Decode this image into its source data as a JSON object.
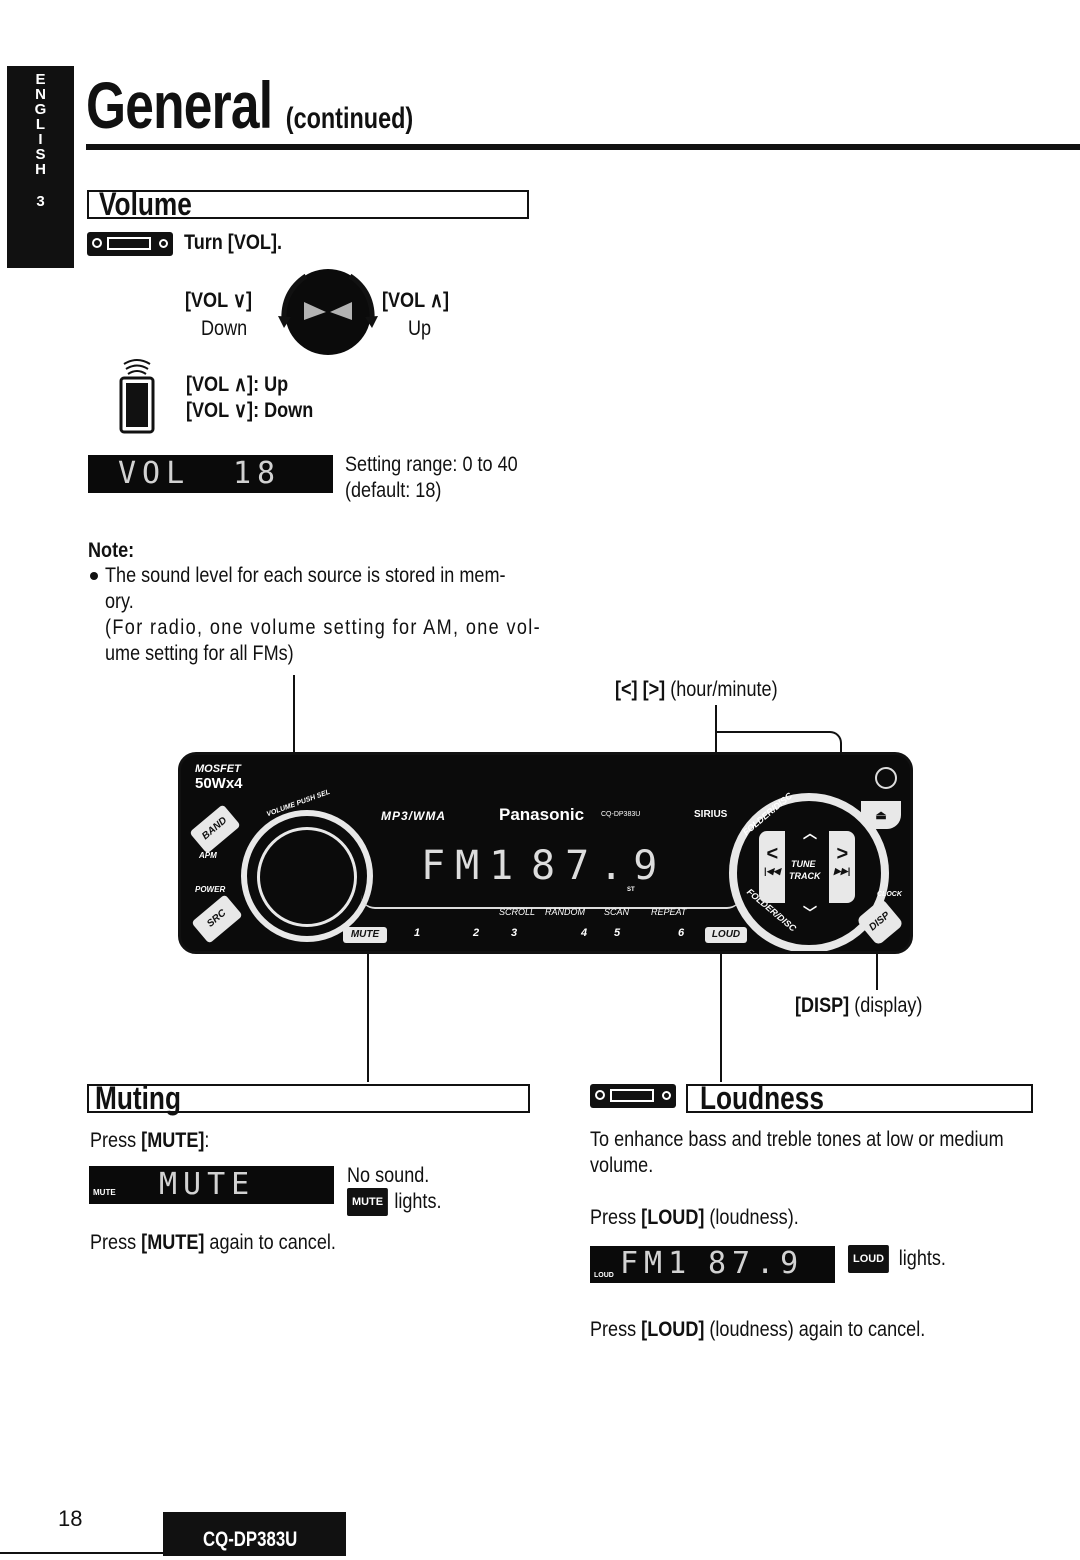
{
  "side_tab": {
    "letters": [
      "E",
      "N",
      "G",
      "L",
      "I",
      "S",
      "H"
    ],
    "number": "3"
  },
  "header": {
    "title": "General",
    "subtitle": "(continued)"
  },
  "volume": {
    "heading": "Volume",
    "instruction": "Turn [VOL].",
    "knob_left_label": "[VOL ∨]",
    "knob_left_sub": "Down",
    "knob_right_label": "[VOL ∧]",
    "knob_right_sub": "Up",
    "remote_line1": "[VOL ∧]: Up",
    "remote_line2": "[VOL ∨]: Down",
    "lcd_text": "VOL",
    "lcd_value": "18",
    "range_line1": "Setting range: 0 to 40",
    "range_line2": "(default: 18)",
    "setting_range": {
      "min": 0,
      "max": 40,
      "default": 18
    },
    "note_heading": "Note:",
    "note_bullet_line1": "The sound level for each source is stored in mem-",
    "note_bullet_line2": "ory.",
    "note_paren_line1": "(For radio, one volume setting for AM, one vol-",
    "note_paren_line2": "ume setting for all FMs)"
  },
  "diagram": {
    "hour_minute_label_keys": "[<] [>]",
    "hour_minute_label_text": "(hour/minute)",
    "disp_label_key": "[DISP]",
    "disp_label_text": "(display)",
    "stereo": {
      "mosfet": "MOSFET",
      "power_rating": "50Wx4",
      "band": "BAND",
      "apm": "APM",
      "power": "POWER",
      "src": "SRC",
      "volume_push_sel": "VOLUME  PUSH SEL",
      "format": "MP3/WMA",
      "brand": "Panasonic",
      "model_small": "CQ-DP383U",
      "sirius": "SIRIUS",
      "display_band": "FM1",
      "display_freq": "87.9",
      "display_small": "ST",
      "mute": "MUTE",
      "loud": "LOUD",
      "presets": [
        "1",
        "2",
        "3",
        "4",
        "5",
        "6"
      ],
      "preset_functions": [
        "SCROLL",
        "RANDOM",
        "SCAN",
        "REPEAT"
      ],
      "folder_disc_top": "FOLDER/DISC",
      "folder_disc_bottom": "FOLDER/DISC",
      "tune_track_1": "TUNE",
      "tune_track_2": "TRACK",
      "left_arrow": "<",
      "right_arrow": ">",
      "clock": "CLOCK",
      "disp": "DISP"
    }
  },
  "muting": {
    "heading": "Muting",
    "press_prefix": "Press ",
    "press_key": "[MUTE]",
    "press_suffix": ":",
    "lcd_text": "MUTE",
    "lcd_indicator": "MUTE",
    "result_line1": "No sound.",
    "result_badge": "MUTE",
    "result_line2": "lights.",
    "cancel_prefix": "Press ",
    "cancel_key": "[MUTE]",
    "cancel_suffix": " again to cancel."
  },
  "loudness": {
    "heading": "Loudness",
    "description_line1": "To enhance bass and treble tones at low or medium",
    "description_line2": "volume.",
    "press_prefix": "Press ",
    "press_key": "[LOUD]",
    "press_suffix": " (loudness).",
    "lcd_band": "FM1",
    "lcd_freq": "87.9",
    "lcd_indicator": "LOUD",
    "result_badge": "LOUD",
    "result_text": "lights.",
    "cancel_prefix": "Press ",
    "cancel_key": "[LOUD]",
    "cancel_suffix": " (loudness) again to cancel."
  },
  "footer": {
    "page_number": "18",
    "model": "CQ-DP383U"
  }
}
